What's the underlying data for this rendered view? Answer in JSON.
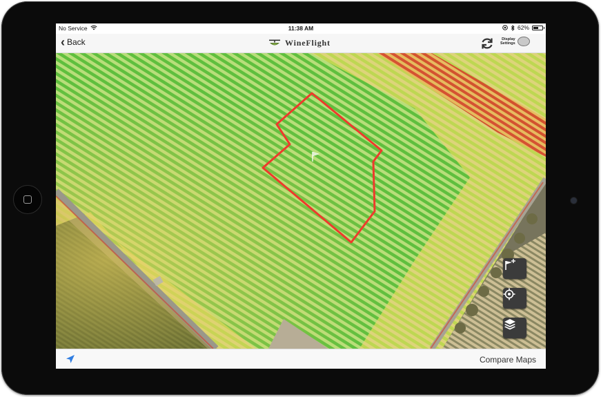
{
  "status_bar": {
    "carrier": "No Service",
    "time": "11:38 AM",
    "battery_percent": "62%",
    "battery_level": 0.62,
    "icons": [
      "wifi-icon",
      "location-arrow-icon",
      "bluetooth-icon",
      "battery-icon"
    ]
  },
  "nav": {
    "back_label": "Back",
    "brand_name": "WineFlight",
    "display_settings_label_line1": "Display",
    "display_settings_label_line2": "Settings",
    "refresh_icon": "refresh-icon"
  },
  "map": {
    "description_colors": {
      "healthy": "#6fc24a",
      "moderate": "#d8d04a",
      "stressed": "#d9482e",
      "boundary": "#ee3a2c"
    },
    "tools": [
      "add-flag-icon",
      "locate-target-icon",
      "layers-icon"
    ]
  },
  "bottom_bar": {
    "compare_label": "Compare Maps",
    "location_icon": "navigation-arrow-icon"
  }
}
